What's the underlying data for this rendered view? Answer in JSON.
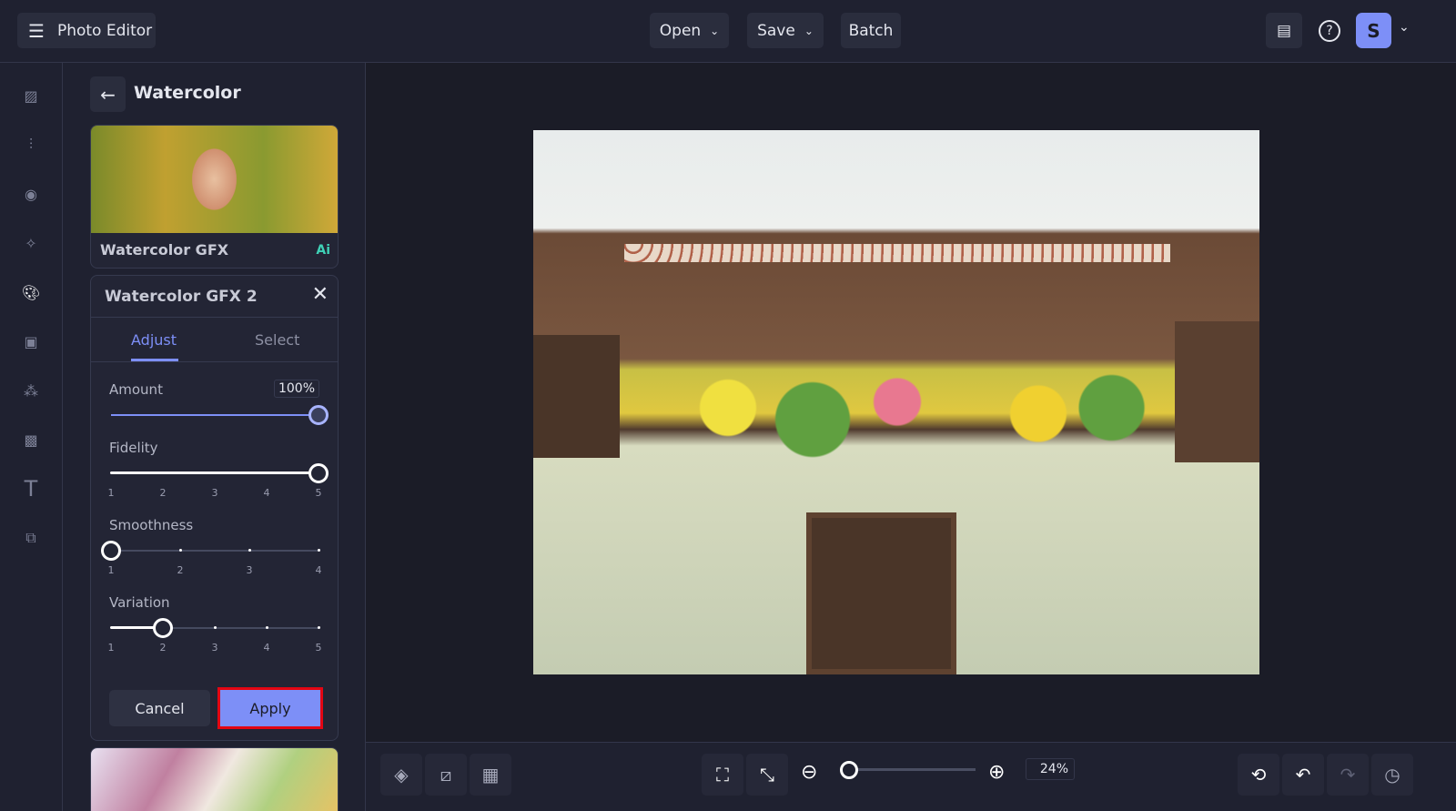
{
  "app": {
    "title": "Photo Editor"
  },
  "header": {
    "open": "Open",
    "save": "Save",
    "batch": "Batch",
    "avatar": "S"
  },
  "panel": {
    "title": "Watercolor",
    "preset_top": {
      "name": "Watercolor GFX",
      "badge": "Ai"
    },
    "active": {
      "name": "Watercolor GFX 2",
      "tabs": [
        {
          "label": "Adjust",
          "active": true
        },
        {
          "label": "Select",
          "active": false
        }
      ],
      "amount": {
        "label": "Amount",
        "value": "100%",
        "fraction": 1.0
      },
      "sliders": [
        {
          "label": "Fidelity",
          "ticks": [
            "1",
            "2",
            "3",
            "4",
            "5"
          ],
          "value": 5
        },
        {
          "label": "Smoothness",
          "ticks": [
            "1",
            "2",
            "3",
            "4"
          ],
          "value": 1
        },
        {
          "label": "Variation",
          "ticks": [
            "1",
            "2",
            "3",
            "4",
            "5"
          ],
          "value": 2
        }
      ],
      "cancel": "Cancel",
      "apply": "Apply"
    }
  },
  "bottom": {
    "zoom": "24%",
    "zoom_fraction": 0.0
  },
  "colors": {
    "accent": "#7d8ff7",
    "highlight": "#e30613",
    "ai": "#3fd1b6"
  }
}
